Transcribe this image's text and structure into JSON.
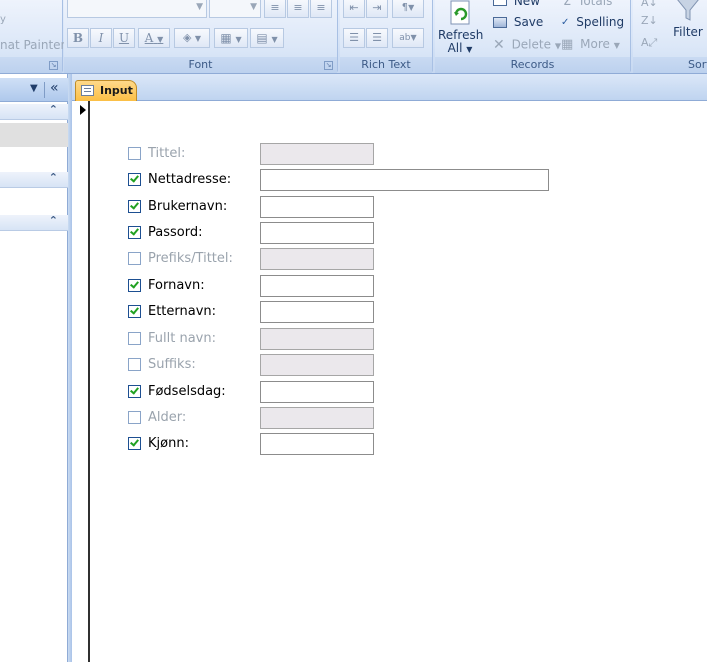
{
  "ribbon": {
    "clipboard": {
      "format_painter_label": "nat Painter"
    },
    "font": {
      "group_label": "Font",
      "bold": "B",
      "italic": "I",
      "underline": "U",
      "font_color": "A"
    },
    "rich_text": {
      "group_label": "Rich Text"
    },
    "records": {
      "group_label": "Records",
      "refresh_label": "Refresh",
      "refresh_sub": "All",
      "new_label": "New",
      "save_label": "Save",
      "delete_label": "Delete",
      "totals_label": "Totals",
      "spelling_label": "Spelling",
      "more_label": "More"
    },
    "sort_filter": {
      "filter_label": "Filter",
      "group_label_partial": "Sort"
    }
  },
  "document": {
    "tab_label": "Input"
  },
  "form": {
    "fields": [
      {
        "label": "Tittel:",
        "checked": false
      },
      {
        "label": "Nettadresse:",
        "checked": true
      },
      {
        "label": "Brukernavn:",
        "checked": true
      },
      {
        "label": "Passord:",
        "checked": true
      },
      {
        "label": "Prefiks/Tittel:",
        "checked": false
      },
      {
        "label": "Fornavn:",
        "checked": true
      },
      {
        "label": "Etternavn:",
        "checked": true
      },
      {
        "label": "Fullt navn:",
        "checked": false
      },
      {
        "label": "Suffiks:",
        "checked": false
      },
      {
        "label": "Fødselsdag:",
        "checked": true
      },
      {
        "label": "Alder:",
        "checked": false
      },
      {
        "label": "Kjønn:",
        "checked": true
      }
    ]
  },
  "colors": {
    "tab_accent": "#fbbf45",
    "check_color": "#21a121",
    "disabled_field": "#ebe8ec"
  }
}
